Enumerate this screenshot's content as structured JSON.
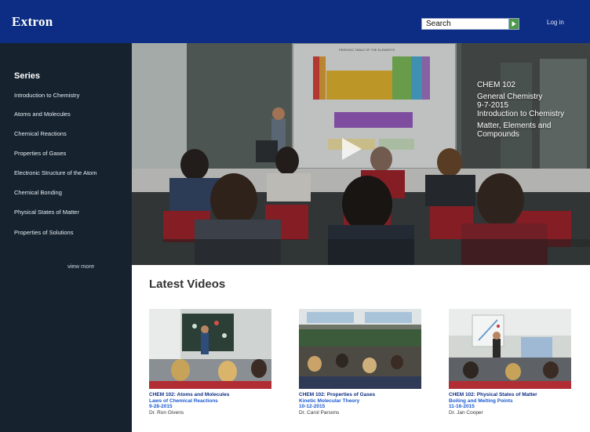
{
  "header": {
    "logo": "Extron",
    "search_placeholder": "Search",
    "login": "Log in"
  },
  "sidebar": {
    "title": "Series",
    "items": [
      "Introduction to Chemistry",
      "Atoms and Molecules",
      "Chemical Reactions",
      "Properties of Gases",
      "Electronic Structure of the Atom",
      "Chemical Bonding",
      "Physical States of Matter",
      "Properties of Solutions"
    ],
    "view_more": "view more"
  },
  "hero": {
    "course": "CHEM 102",
    "subject": "General Chemistry",
    "date": "9-7-2015",
    "series": "Introduction to Chemistry",
    "title": "Matter, Elements and Compounds",
    "slide_title": "PERIODIC TABLE OF THE ELEMENTS"
  },
  "latest": {
    "heading": "Latest Videos",
    "videos": [
      {
        "course": "CHEM 102: Atoms and Molecules",
        "title": "Laws of Chemical Reactions",
        "date": "9-28-2015",
        "instructor": "Dr. Ron Givens"
      },
      {
        "course": "CHEM 102: Properties of Gases",
        "title": "Kinetic Molecular Theory",
        "date": "10-12-2015",
        "instructor": "Dr. Carol Parsons"
      },
      {
        "course": "CHEM 102: Physical States of Matter",
        "title": "Boiling and Melting Points",
        "date": "11-16-2015",
        "instructor": "Dr. Jan Cooper"
      }
    ]
  },
  "colors": {
    "header_bg": "#0c2d83",
    "sidebar_bg": "#16232f",
    "link_blue": "#1b5ad1",
    "search_button": "#4c9a4a"
  },
  "icons": {
    "search_button": "search-go-icon",
    "hero_play": "play-icon"
  }
}
